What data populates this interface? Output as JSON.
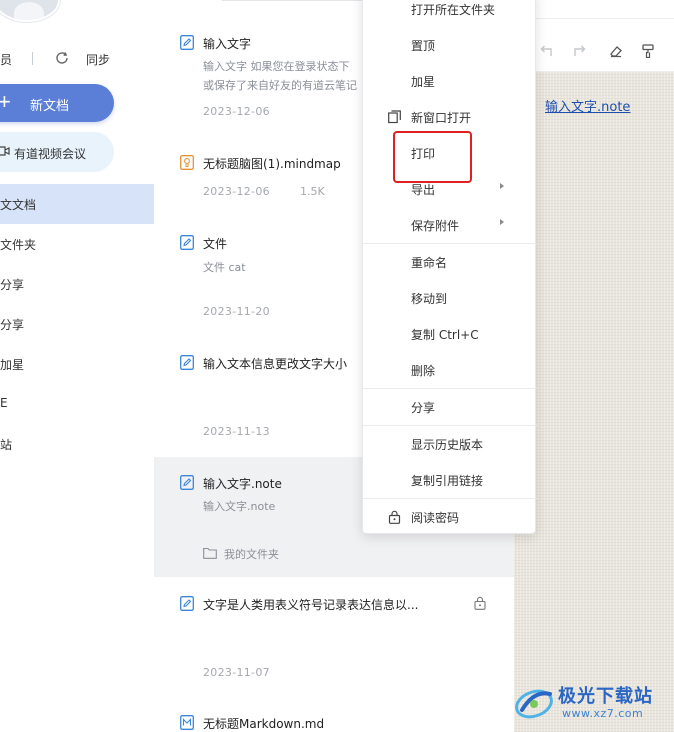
{
  "sidebar": {
    "member": "员",
    "sync": "同步",
    "new_doc": "新文档",
    "video_meeting": "有道视频会议",
    "nav": [
      "文文档",
      "文件夹",
      "分享",
      "分享",
      "加星",
      "E",
      "站"
    ]
  },
  "list": {
    "items": [
      {
        "title": "输入文字",
        "snippet_lines": [
          "输入文字 如果您在登录状态下",
          "或保存了来自好友的有道云笔记"
        ],
        "date": "2023-12-06"
      },
      {
        "title": "无标题脑图(1).mindmap",
        "date": "2023-12-06",
        "size": "1.5K"
      },
      {
        "title": "文件",
        "snippet_lines": [
          "文件 cat"
        ],
        "date": "2023-11-20"
      },
      {
        "title": "输入文本信息更改文字大小",
        "date": "2023-11-13"
      },
      {
        "title": "输入文字.note",
        "snippet_lines": [
          "输入文字.note"
        ],
        "folder": "我的文件夹"
      },
      {
        "title": "文字是人类用表义符号记录表达信息以...",
        "date": "2023-11-07"
      },
      {
        "title": "无标题Markdown.md"
      }
    ]
  },
  "editor": {
    "link_text": "输入文字.note"
  },
  "menu": {
    "items": [
      {
        "label": "打开所在文件夹"
      },
      {
        "label": "置顶"
      },
      {
        "label": "加星"
      },
      {
        "label": "新窗口打开"
      },
      {
        "label": "打印"
      },
      {
        "label": "导出"
      },
      {
        "label": "保存附件"
      },
      {
        "label": "重命名"
      },
      {
        "label": "移动到"
      },
      {
        "label": "复制 Ctrl+C"
      },
      {
        "label": "删除"
      },
      {
        "label": "分享"
      },
      {
        "label": "显示历史版本"
      },
      {
        "label": "复制引用链接"
      },
      {
        "label": "阅读密码"
      }
    ]
  },
  "watermark": {
    "name": "极光下载站",
    "url": "www.xz7.com"
  },
  "colors": {
    "accent": "#5b7fd6",
    "nav_active": "#d6e3f8",
    "highlight_box": "#e02020",
    "link": "#1e4fb0"
  }
}
